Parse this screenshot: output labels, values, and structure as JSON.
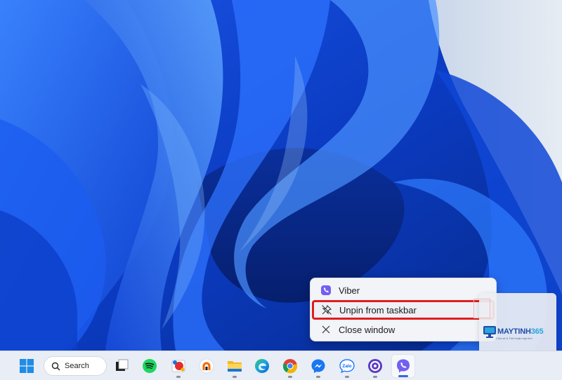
{
  "context_menu": {
    "items": [
      {
        "label": "Viber",
        "icon": "viber-icon"
      },
      {
        "label": "Unpin from taskbar",
        "icon": "unpin-icon",
        "highlighted": true
      },
      {
        "label": "Close window",
        "icon": "close-icon"
      }
    ]
  },
  "taskbar": {
    "search_label": "Search",
    "apps": [
      {
        "name": "start",
        "icon": "windows-start-icon"
      },
      {
        "name": "task-view",
        "icon": "task-view-icon"
      },
      {
        "name": "spotify",
        "icon": "spotify-icon"
      },
      {
        "name": "paint",
        "icon": "paint-icon"
      },
      {
        "name": "vpn",
        "icon": "vpn-icon"
      },
      {
        "name": "file-explorer",
        "icon": "folder-icon"
      },
      {
        "name": "edge",
        "icon": "edge-icon"
      },
      {
        "name": "chrome",
        "icon": "chrome-icon"
      },
      {
        "name": "messenger",
        "icon": "messenger-icon"
      },
      {
        "name": "zalo",
        "icon": "zalo-icon",
        "label": "Zalo"
      },
      {
        "name": "webex",
        "icon": "webex-icon"
      },
      {
        "name": "viber",
        "icon": "viber-icon",
        "active": true
      }
    ]
  },
  "watermark": {
    "brand_main": "MAYTINH",
    "brand_accent": "365",
    "tagline": "Chia sẻ & Thủ thuật máy tính",
    "url": "www.maytinh365.vn"
  },
  "colors": {
    "accent_blue": "#3768d9",
    "highlight_red": "#e01d1d",
    "viber_purple": "#7360f2",
    "wallpaper_deep": "#0a2c8c",
    "wallpaper_light": "#dfe6ef"
  }
}
